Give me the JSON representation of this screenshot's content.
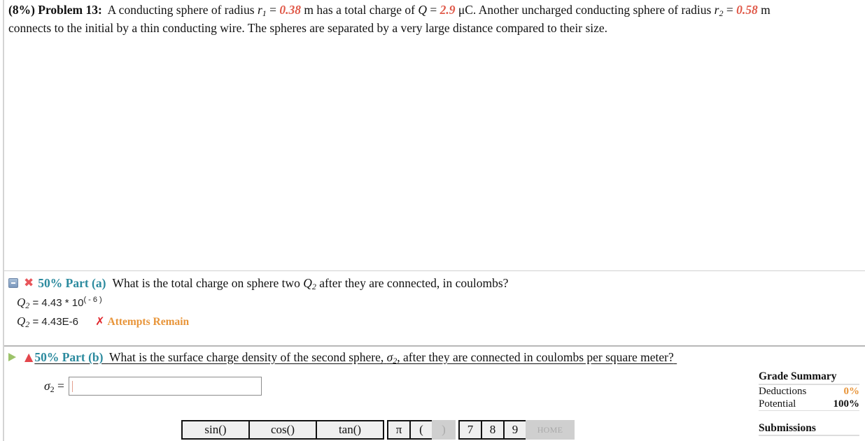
{
  "problem": {
    "weight": "(8%)",
    "title": "Problem 13:",
    "text_1": "A conducting sphere of radius",
    "r1_var": "r",
    "r1_sub": "1",
    "eq": "=",
    "r1_value": "0.38",
    "r1_unit": "m has a total charge of",
    "q_var": "Q",
    "q_value": "2.9",
    "q_unit": "μC. Another uncharged conducting sphere of radius",
    "r2_var": "r",
    "r2_sub": "2",
    "r2_value": "0.58",
    "r2_unit": "m",
    "text_2": "connects to the initial by a thin conducting wire. The spheres are separated by a very large distance compared to their size."
  },
  "part_a": {
    "label": "50% Part (a)",
    "question_1": "What is the total charge on sphere two",
    "q_var": "Q",
    "q_sub": "2",
    "question_2": "after they are connected, in coulombs?",
    "answer_expr_prefix": "= 4.43 * 10",
    "answer_expr_exp": "( - 6 )",
    "answer_value": "= 4.43E-6",
    "status_mark": "✗",
    "status_text": "Attempts Remain"
  },
  "part_b": {
    "label": "50% Part (b)",
    "question_1": "What is the surface charge density of the second sphere,",
    "sigma_var": "σ",
    "sigma_sub": "2",
    "question_2": ", after they are connected in coulombs per square meter?",
    "input_label_eq": "=",
    "input_value": ""
  },
  "keypad": {
    "keys": [
      "sin()",
      "cos()",
      "tan()",
      "π",
      "(",
      ")",
      "7",
      "8",
      "9",
      "HOME"
    ]
  },
  "grade_summary": {
    "title": "Grade Summary",
    "deductions_label": "Deductions",
    "deductions_value": "0%",
    "potential_label": "Potential",
    "potential_value": "100%"
  },
  "submissions": {
    "title": "Submissions"
  },
  "colors": {
    "value_red": "#e05a4a",
    "part_teal": "#2b8a9e",
    "attempts_orange": "#e8953a"
  }
}
